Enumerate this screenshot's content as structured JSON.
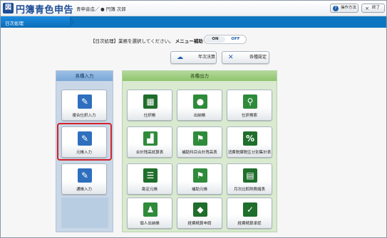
{
  "app": {
    "title": "円簿青色申告",
    "logo_glyph": "図",
    "crumb": "青申音造／",
    "user": "● 円簿 次郎"
  },
  "titlebar_buttons": {
    "help": {
      "label": "操作方法",
      "icon": "question-icon"
    },
    "close": {
      "label": "終了",
      "icon": "close-icon"
    }
  },
  "nav": {
    "current": "日次処理"
  },
  "instruction": {
    "text": "【日次処理】業務を選択してください。",
    "menu_assist_label": "メニュー補助"
  },
  "toggle": {
    "on": "ON",
    "off": "OFF"
  },
  "top_buttons": {
    "closing": {
      "label": "年次決算",
      "icon": "cloud-icon"
    },
    "settings": {
      "label": "各種設定",
      "icon": "wrench-icon"
    }
  },
  "left_panel": {
    "title": "各種入力",
    "items": [
      {
        "label": "複合仕訳入力",
        "icon": "pencil-ledger-icon"
      },
      {
        "label": "元帳入力",
        "icon": "pencil-ledger-icon",
        "selected": true
      },
      {
        "label": "通帳入力",
        "icon": "pencil-passbook-icon"
      }
    ]
  },
  "right_panel": {
    "title": "各種出力",
    "items": [
      {
        "label": "仕訳帳",
        "icon": "grid-book-icon"
      },
      {
        "label": "出納帳",
        "icon": "coins-ledger-icon"
      },
      {
        "label": "仕訳検索",
        "icon": "magnifier-icon"
      },
      {
        "label": "合計残高試算表",
        "icon": "bar-chart-icon"
      },
      {
        "label": "補助科目合計残高表",
        "icon": "flag-chart-icon"
      },
      {
        "label": "消費税課税区分別集計表",
        "icon": "percent-icon"
      },
      {
        "label": "勘定元帳",
        "icon": "document-list-icon"
      },
      {
        "label": "補助元帳",
        "icon": "flag-book-icon"
      },
      {
        "label": "月次比較財務諸表",
        "icon": "clipboard-icon"
      },
      {
        "label": "個人出納帳",
        "icon": "person-ledger-icon"
      },
      {
        "label": "経費精算申請",
        "icon": "wallet-icon"
      },
      {
        "label": "経費精算承認",
        "icon": "approval-icon"
      }
    ]
  },
  "colors": {
    "nav": "#0e76c0",
    "left_panel": "#c9d7e6",
    "right_panel": "#d9ead1",
    "selection": "#d2232a",
    "brand": "#1f4e96"
  }
}
